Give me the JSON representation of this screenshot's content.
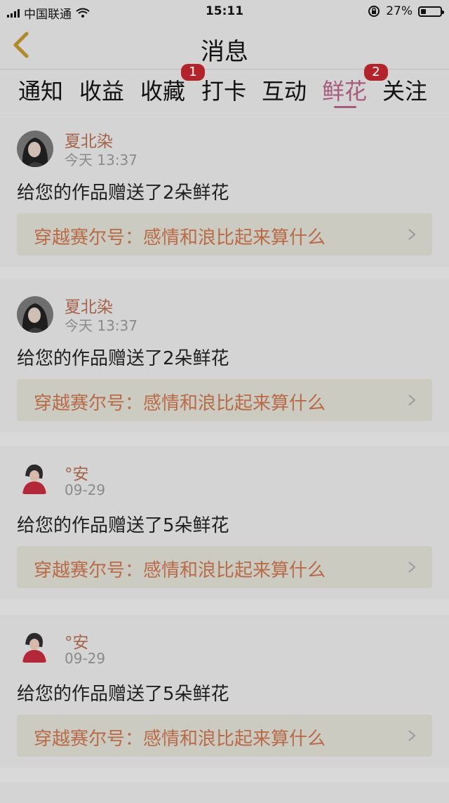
{
  "status_bar": {
    "carrier": "中国联通",
    "time": "15:11",
    "battery_text": "27%",
    "battery_level": 0.27
  },
  "header": {
    "title": "消息",
    "back_icon": "chevron-left-icon"
  },
  "tabs": [
    {
      "label": "通知",
      "badge": null
    },
    {
      "label": "收益",
      "badge": null
    },
    {
      "label": "收藏",
      "badge": "1"
    },
    {
      "label": "打卡",
      "badge": null
    },
    {
      "label": "互动",
      "badge": null
    },
    {
      "label": "鲜花",
      "badge": "2",
      "active": true
    },
    {
      "label": "关注",
      "badge": null
    }
  ],
  "messages": [
    {
      "username": "夏北染",
      "time": "今天 13:37",
      "message": "给您的作品赠送了2朵鲜花",
      "work_title": "穿越赛尔号：感情和浪比起来算什么"
    },
    {
      "username": "夏北染",
      "time": "今天 13:37",
      "message": "给您的作品赠送了2朵鲜花",
      "work_title": "穿越赛尔号：感情和浪比起来算什么"
    },
    {
      "username": "°安",
      "time": "09-29",
      "message": "给您的作品赠送了5朵鲜花",
      "work_title": "穿越赛尔号：感情和浪比起来算什么"
    },
    {
      "username": "°安",
      "time": "09-29",
      "message": "给您的作品赠送了5朵鲜花",
      "work_title": "穿越赛尔号：感情和浪比起来算什么"
    }
  ],
  "colors": {
    "accent": "#a85a7c",
    "badge": "#b3232b",
    "username": "#a5634a",
    "link_text": "#b96a47"
  }
}
